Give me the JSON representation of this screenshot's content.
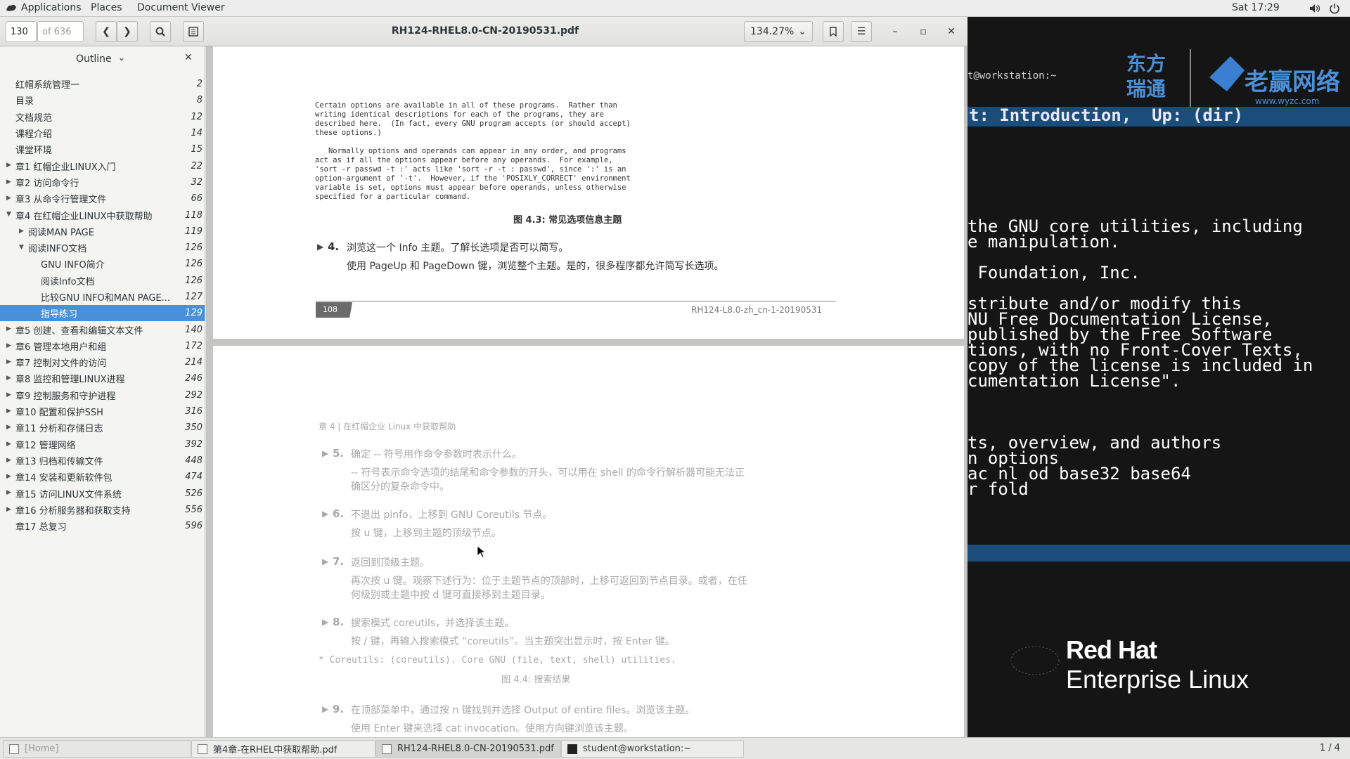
{
  "topbar": {
    "applications": "Applications",
    "places": "Places",
    "app_name": "Document Viewer",
    "clock": "Sat 17:29"
  },
  "viewer": {
    "page_number": "130",
    "page_of": "of 636",
    "doc_title": "RH124-RHEL8.0-CN-20190531.pdf",
    "zoom": "134.27%"
  },
  "sidebar": {
    "header": "Outline",
    "items": [
      {
        "label": "红帽系统管理一",
        "page": "2",
        "indent": 0,
        "tri": ""
      },
      {
        "label": "目录",
        "page": "8",
        "indent": 0,
        "tri": ""
      },
      {
        "label": "文档规范",
        "page": "12",
        "indent": 0,
        "tri": ""
      },
      {
        "label": "课程介绍",
        "page": "14",
        "indent": 0,
        "tri": ""
      },
      {
        "label": "课堂环境",
        "page": "15",
        "indent": 0,
        "tri": ""
      },
      {
        "label": "章1 红帽企业LINUX入门",
        "page": "22",
        "indent": 0,
        "tri": "▶"
      },
      {
        "label": "章2 访问命令行",
        "page": "32",
        "indent": 0,
        "tri": "▶"
      },
      {
        "label": "章3 从命令行管理文件",
        "page": "66",
        "indent": 0,
        "tri": "▶"
      },
      {
        "label": "章4 在红帽企业LINUX中获取帮助",
        "page": "118",
        "indent": 0,
        "tri": "▼"
      },
      {
        "label": "阅读MAN PAGE",
        "page": "119",
        "indent": 1,
        "tri": "▶"
      },
      {
        "label": "阅读INFO文档",
        "page": "126",
        "indent": 1,
        "tri": "▼"
      },
      {
        "label": "GNU INFO简介",
        "page": "126",
        "indent": 2,
        "tri": ""
      },
      {
        "label": "阅读Info文档",
        "page": "126",
        "indent": 2,
        "tri": ""
      },
      {
        "label": "比较GNU INFO和MAN PAGE...",
        "page": "127",
        "indent": 2,
        "tri": ""
      },
      {
        "label": "指导练习",
        "page": "129",
        "indent": 2,
        "tri": "",
        "selected": true
      },
      {
        "label": "章5 创建、查看和编辑文本文件",
        "page": "140",
        "indent": 0,
        "tri": "▶"
      },
      {
        "label": "章6 管理本地用户和组",
        "page": "172",
        "indent": 0,
        "tri": "▶"
      },
      {
        "label": "章7 控制对文件的访问",
        "page": "214",
        "indent": 0,
        "tri": "▶"
      },
      {
        "label": "章8 监控和管理LINUX进程",
        "page": "246",
        "indent": 0,
        "tri": "▶"
      },
      {
        "label": "章9 控制服务和守护进程",
        "page": "292",
        "indent": 0,
        "tri": "▶"
      },
      {
        "label": "章10 配置和保护SSH",
        "page": "316",
        "indent": 0,
        "tri": "▶"
      },
      {
        "label": "章11 分析和存储日志",
        "page": "350",
        "indent": 0,
        "tri": "▶"
      },
      {
        "label": "章12 管理网络",
        "page": "392",
        "indent": 0,
        "tri": "▶"
      },
      {
        "label": "章13 归档和传输文件",
        "page": "448",
        "indent": 0,
        "tri": "▶"
      },
      {
        "label": "章14 安装和更新软件包",
        "page": "474",
        "indent": 0,
        "tri": "▶"
      },
      {
        "label": "章15 访问LINUX文件系统",
        "page": "526",
        "indent": 0,
        "tri": "▶"
      },
      {
        "label": "章16 分析服务器和获取支持",
        "page": "556",
        "indent": 0,
        "tri": "▶"
      },
      {
        "label": "章17 总复习",
        "page": "596",
        "indent": 0,
        "tri": ""
      }
    ]
  },
  "page1": {
    "mono_text": "Certain options are available in all of these programs.  Rather than\nwriting identical descriptions for each of the programs, they are\ndescribed here.  (In fact, every GNU program accepts (or should accept)\nthese options.)\n\n   Normally options and operands can appear in any order, and programs\nact as if all the options appear before any operands.  For example,\n'sort -r passwd -t :' acts like 'sort -r -t : passwd', since ':' is an\noption-argument of '-t'.  However, if the 'POSIXLY_CORRECT' environment\nvariable is set, options must appear before operands, unless otherwise\nspecified for a particular command.",
    "fig_caption": "图 4.3: 常见选项信息主题",
    "step4_num": "4.",
    "step4_line1": "浏览这一个 Info 主题。了解长选项是否可以简写。",
    "step4_line2": "使用 PageUp 和 PageDown 键，浏览整个主题。是的，很多程序都允许简写长选项。",
    "footer_page": "108",
    "footer_doc": "RH124-L8.0-zh_cn-1-20190531"
  },
  "page2": {
    "chapter_header": "章 4 | 在红帽企业 Linux 中获取帮助",
    "step5_num": "5.",
    "step5_line1": "确定 -- 符号用作命令参数时表示什么。",
    "step5_line2": "-- 符号表示命令选项的结尾和命令参数的开头，可以用在 shell 的命令行解析器可能无法正",
    "step5_line3": "确区分的复杂命令中。",
    "step6_num": "6.",
    "step6_line1": "不退出 pinfo，上移到 GNU Coreutils 节点。",
    "step6_line2": "按 u 键，上移到主题的顶级节点。",
    "step7_num": "7.",
    "step7_line1": "返回到顶级主题。",
    "step7_line2": "再次按 u 键。观察下述行为：位于主题节点的顶部时，上移可返回到节点目录。或者，在任",
    "step7_line3": "何级别或主题中按 d 键可直接移到主题目录。",
    "step8_num": "8.",
    "step8_line1": "搜索模式 coreutils，并选择该主题。",
    "step8_line2": "按 / 键，再输入搜索模式 “coreutils”。当主题突出显示时，按 Enter 键。",
    "search_result": "* Coreutils: (coreutils).        Core GNU (file, text, shell) utilities.",
    "fig_caption2": "图 4.4: 搜索结果",
    "step9_num": "9.",
    "step9_line1": "在顶部菜单中，通过按 n 键找到并选择 Output of entire files。浏览该主题。",
    "step9_line2": "使用 Enter 键来选择 cat invocation。使用方向键浏览该主题。"
  },
  "terminal": {
    "prompt": "t@workstation:~",
    "header": "t: Introduction,  Up: (dir)",
    "lines": [
      "the GNU core utilities, including",
      "e manipulation.",
      "",
      " Foundation, Inc.",
      "",
      "stribute and/or modify this",
      "NU Free Documentation License,",
      "published by the Free Software",
      "tions, with no Front-Cover Texts,",
      "copy of the license is included in",
      "cumentation License\".",
      "",
      "",
      "",
      "ts, overview, and authors",
      "n options",
      "ac nl od base32 base64",
      "r fold"
    ]
  },
  "desktop": {
    "redhat_line1": "Red Hat",
    "redhat_line2": "Enterprise Linux"
  },
  "taskbar": {
    "home": "[Home]",
    "task1": "第4章-在RHEL中获取帮助.pdf",
    "task2": "RH124-RHEL8.0-CN-20190531.pdf",
    "task3": "student@workstation:~",
    "pager": "1 / 4"
  }
}
